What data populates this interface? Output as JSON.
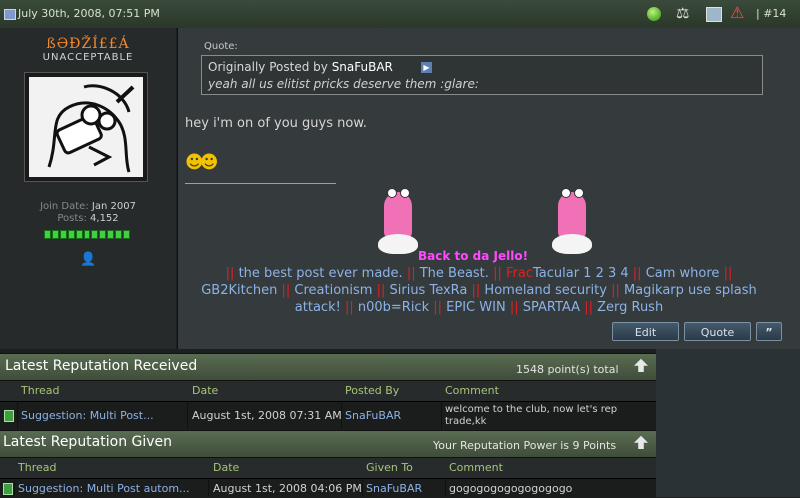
{
  "post": {
    "date": "July 30th, 2008, 07:51 PM",
    "number": "#14",
    "separator": "|"
  },
  "user": {
    "username": "ßӘÐŽÍ££Á",
    "title": "UNACCEPTABLE",
    "join_label": "Join Date:",
    "join_value": "Jan 2007",
    "posts_label": "Posts:",
    "posts_value": "4,152",
    "reputation_pips": 11
  },
  "quote": {
    "label": "Quote:",
    "prefix": "Originally Posted by",
    "author": "SnaFuBAR",
    "text": "yeah all us elitist pricks deserve them :glare:"
  },
  "message": "hey i'm on of you guys now.",
  "smiley": "☻☻",
  "signature": {
    "jello": "Back to da Jello!",
    "sep": "||",
    "items": [
      "the best post ever made.",
      "The Beast.",
      "Tacular 1 2 3 4",
      "Cam whore",
      "GB2Kitchen",
      "Creationism",
      "Sirius TexRa",
      "Homeland security",
      "Magikarp use splash attack!",
      "n00b=Rick",
      "EPIC WIN",
      "SPARTAA",
      "Zerg Rush"
    ],
    "frac_prefix": "Frac"
  },
  "buttons": {
    "edit": "Edit",
    "quote": "Quote",
    "multiquote": "”"
  },
  "rep_received": {
    "title": "Latest Reputation Received",
    "total": "1548 point(s) total",
    "columns": [
      "Thread",
      "Date",
      "Posted By",
      "Comment"
    ],
    "row": {
      "thread": "Suggestion: Multi Post...",
      "date": "August 1st, 2008 07:31 AM",
      "by": "SnaFuBAR",
      "comment1": "welcome to the club, now let's rep",
      "comment2": "trade,kk"
    }
  },
  "rep_given": {
    "title": "Latest Reputation Given",
    "power": "Your Reputation Power is 9 Points",
    "columns": [
      "Thread",
      "Date",
      "Given To",
      "Comment"
    ],
    "row": {
      "thread": "Suggestion: Multi Post autom...",
      "date": "August 1st, 2008 04:06 PM",
      "to": "SnaFuBAR",
      "comment": "gogogogogogogogogo"
    }
  },
  "icons": {
    "date": "post-date-icon",
    "online": "online-status-icon",
    "scales": "report-scales-icon",
    "computer": "ip-computer-icon",
    "warning": "warn-icon",
    "collapse": "collapse-arrow-icon",
    "user": "user-profile-icon",
    "rep": "reputation-icon"
  }
}
